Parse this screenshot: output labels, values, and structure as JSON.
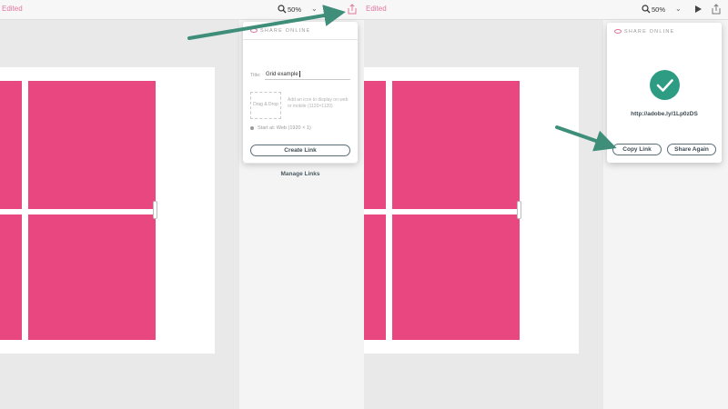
{
  "left": {
    "toolbar": {
      "title": "Edited",
      "zoom": "50%"
    },
    "share_panel": {
      "header": "SHARE ONLINE",
      "title_label": "Title:",
      "title_value": "Grid example",
      "drop_label": "Drag & Drop",
      "drop_help": "Add an icon to display on web or mobile (1120×1120)",
      "start_at": "Start at: Web (1920 × 1)",
      "create_link": "Create Link",
      "manage_links": "Manage Links"
    }
  },
  "right": {
    "toolbar": {
      "title": "Edited",
      "zoom": "50%"
    },
    "share_panel": {
      "header": "SHARE ONLINE",
      "url": "http://adobe.ly/1Lp0zDS",
      "copy_link": "Copy Link",
      "share_again": "Share Again"
    }
  },
  "colors": {
    "accent_pink": "#e8487f",
    "success_green": "#2e9c83",
    "arrow_teal": "#3e8e7a"
  },
  "icons": [
    "search-icon",
    "chevron-down-icon",
    "share-icon",
    "play-icon",
    "eye-icon",
    "checkmark-icon"
  ]
}
